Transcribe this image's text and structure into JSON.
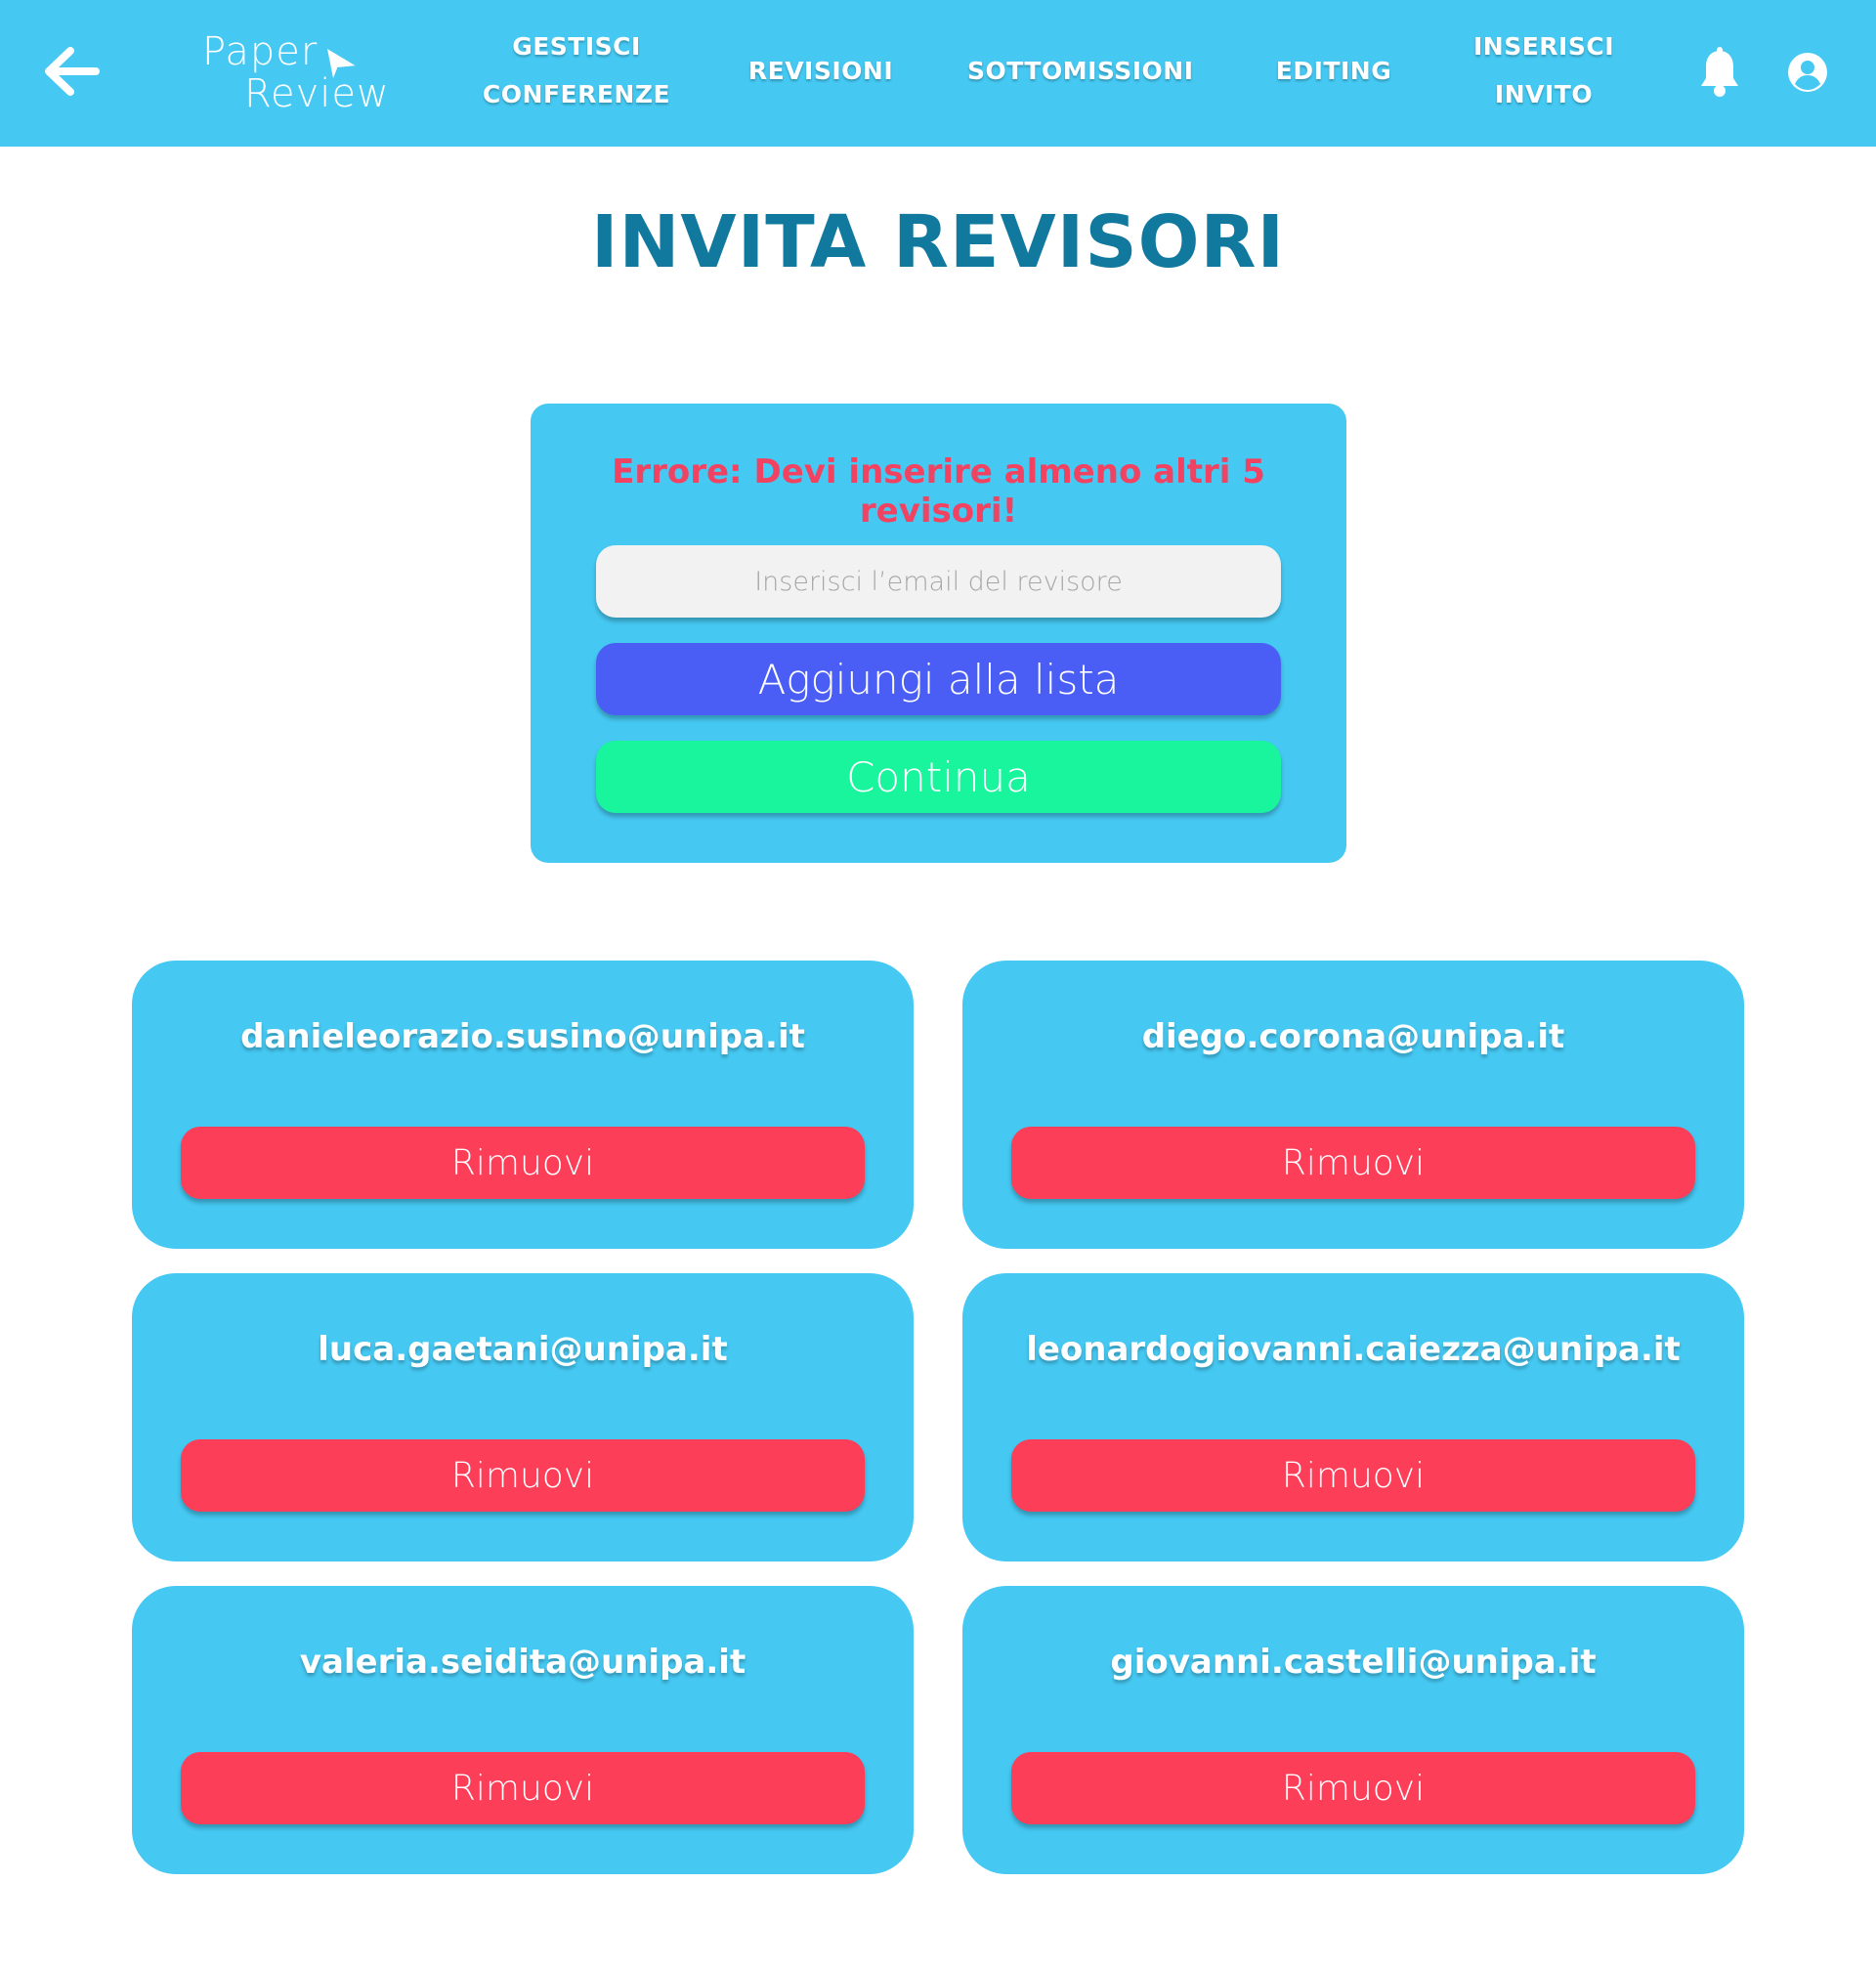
{
  "header": {
    "logo_line1": "Paper",
    "logo_line2": "Review",
    "nav": [
      {
        "line1": "GESTISCI",
        "line2": "CONFERENZE"
      },
      {
        "line1": "REVISIONI"
      },
      {
        "line1": "SOTTOMISSIONI"
      },
      {
        "line1": "EDITING"
      },
      {
        "line1": "INSERISCI",
        "line2": "INVITO"
      }
    ],
    "icons": [
      "back-arrow-icon",
      "bell-icon",
      "account-icon"
    ]
  },
  "page_title": "INVITA REVISORI",
  "form": {
    "error": "Errore: Devi inserire almeno altri 5 revisori!",
    "email_placeholder": "Inserisci l’email del revisore",
    "email_value": "",
    "add_label": "Aggiungi alla lista",
    "continue_label": "Continua"
  },
  "reviewers": [
    {
      "email": "danieleorazio.susino@unipa.it",
      "remove_label": "Rimuovi"
    },
    {
      "email": "diego.corona@unipa.it",
      "remove_label": "Rimuovi"
    },
    {
      "email": "luca.gaetani@unipa.it",
      "remove_label": "Rimuovi"
    },
    {
      "email": "leonardogiovanni.caiezza@unipa.it",
      "remove_label": "Rimuovi"
    },
    {
      "email": "valeria.seidita@unipa.it",
      "remove_label": "Rimuovi"
    },
    {
      "email": "giovanni.castelli@unipa.it",
      "remove_label": "Rimuovi"
    }
  ],
  "colors": {
    "header_bg": "#45c8f2",
    "title": "#12799e",
    "error": "#f24262",
    "add_button": "#4a5ef5",
    "continue_button": "#19f59c",
    "remove_button": "#fd3e59",
    "card_bg": "#45c8f2"
  }
}
